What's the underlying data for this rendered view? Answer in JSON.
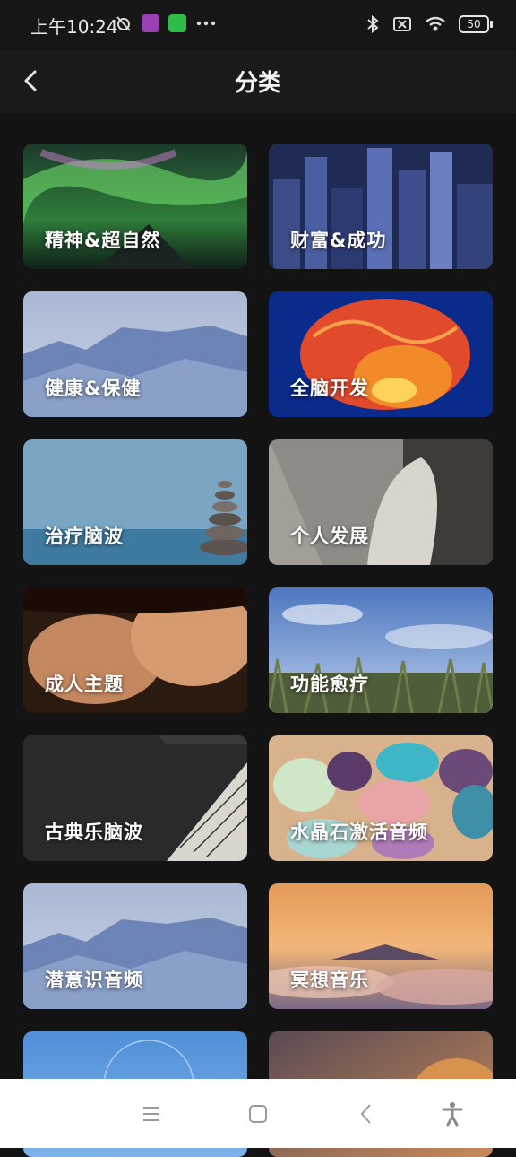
{
  "status": {
    "time": "上午10:24",
    "battery": "50"
  },
  "header": {
    "title": "分类",
    "back_icon": "chevron-left-icon"
  },
  "categories": [
    {
      "label": "精神&超自然",
      "theme": "aurora"
    },
    {
      "label": "财富&成功",
      "theme": "city"
    },
    {
      "label": "健康&保健",
      "theme": "mountains"
    },
    {
      "label": "全脑开发",
      "theme": "brain"
    },
    {
      "label": "治疗脑波",
      "theme": "stones"
    },
    {
      "label": "个人发展",
      "theme": "hands"
    },
    {
      "label": "成人主题",
      "theme": "couple"
    },
    {
      "label": "功能愈疗",
      "theme": "field"
    },
    {
      "label": "古典乐脑波",
      "theme": "sheet-music"
    },
    {
      "label": "水晶石激活音频",
      "theme": "crystals"
    },
    {
      "label": "潜意识音频",
      "theme": "mountains"
    },
    {
      "label": "冥想音乐",
      "theme": "sunset-clouds"
    },
    {
      "label": "",
      "theme": "blue-sky"
    },
    {
      "label": "",
      "theme": "sunset-dog"
    }
  ],
  "nav": {
    "menu_icon": "menu-icon",
    "home_icon": "home-icon",
    "back_icon": "back-icon",
    "accessibility_icon": "accessibility-icon"
  }
}
